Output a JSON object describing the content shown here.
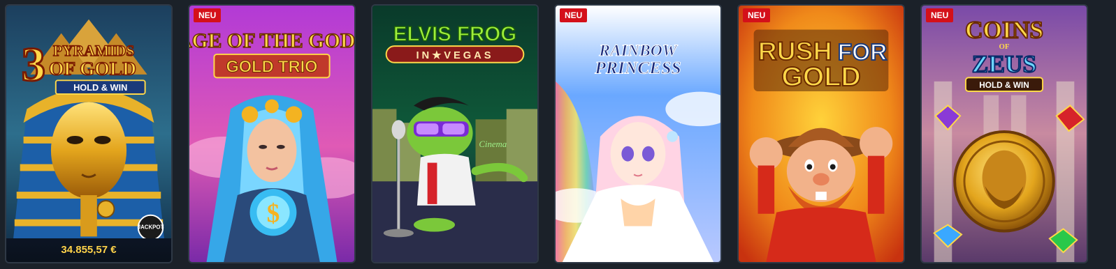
{
  "cards": [
    {
      "title_line1": "3",
      "title_line2": "PYRAMIDS",
      "title_line3": "OF GOLD",
      "subtitle": "HOLD & WIN",
      "jackpot_label": "JACKPOT",
      "jackpot_amount": "34.855,57 €"
    },
    {
      "badge": "NEU",
      "title_line1": "AGE OF THE GODS",
      "title_line2": "GOLD TRIO"
    },
    {
      "title_line1": "ELVIS FROG",
      "title_line2": "IN★VEGAS",
      "sign": "Cinema"
    },
    {
      "badge": "NEU",
      "title_line1": "RAINBOW",
      "title_line2": "PRINCESS"
    },
    {
      "badge": "NEU",
      "title_line1": "RUSH",
      "title_for": "FOR",
      "title_line2": "GOLD"
    },
    {
      "badge": "NEU",
      "title_line1": "COINS",
      "title_of": "OF",
      "title_line2": "ZEUS",
      "subtitle": "HOLD & WIN"
    }
  ],
  "colors": {
    "background": "#1b2129",
    "badge": "#d4101a",
    "jackpot_text": "#ffd34a"
  }
}
